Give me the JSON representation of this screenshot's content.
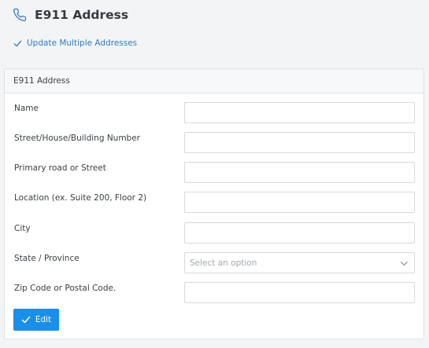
{
  "header": {
    "icon": "phone-icon",
    "title": "E911 Address"
  },
  "update_link": {
    "icon": "check-icon",
    "label": "Update Multiple Addresses"
  },
  "card": {
    "title": "E911 Address",
    "fields": [
      {
        "label": "Name",
        "value": ""
      },
      {
        "label": "Street/House/Building Number",
        "value": ""
      },
      {
        "label": "Primary road or Street",
        "value": ""
      },
      {
        "label": "Location (ex. Suite 200, Floor 2)",
        "value": ""
      },
      {
        "label": "City",
        "value": ""
      },
      {
        "label": "State / Province",
        "placeholder": "Select an option",
        "icon": "chevron-down-icon"
      },
      {
        "label": "Zip Code or Postal Code.",
        "value": ""
      }
    ],
    "edit_button": {
      "icon": "check-icon",
      "label": "Edit"
    }
  },
  "colors": {
    "accent": "#1a8fea",
    "link": "#2f7bbf",
    "background": "#f3f4f6"
  }
}
